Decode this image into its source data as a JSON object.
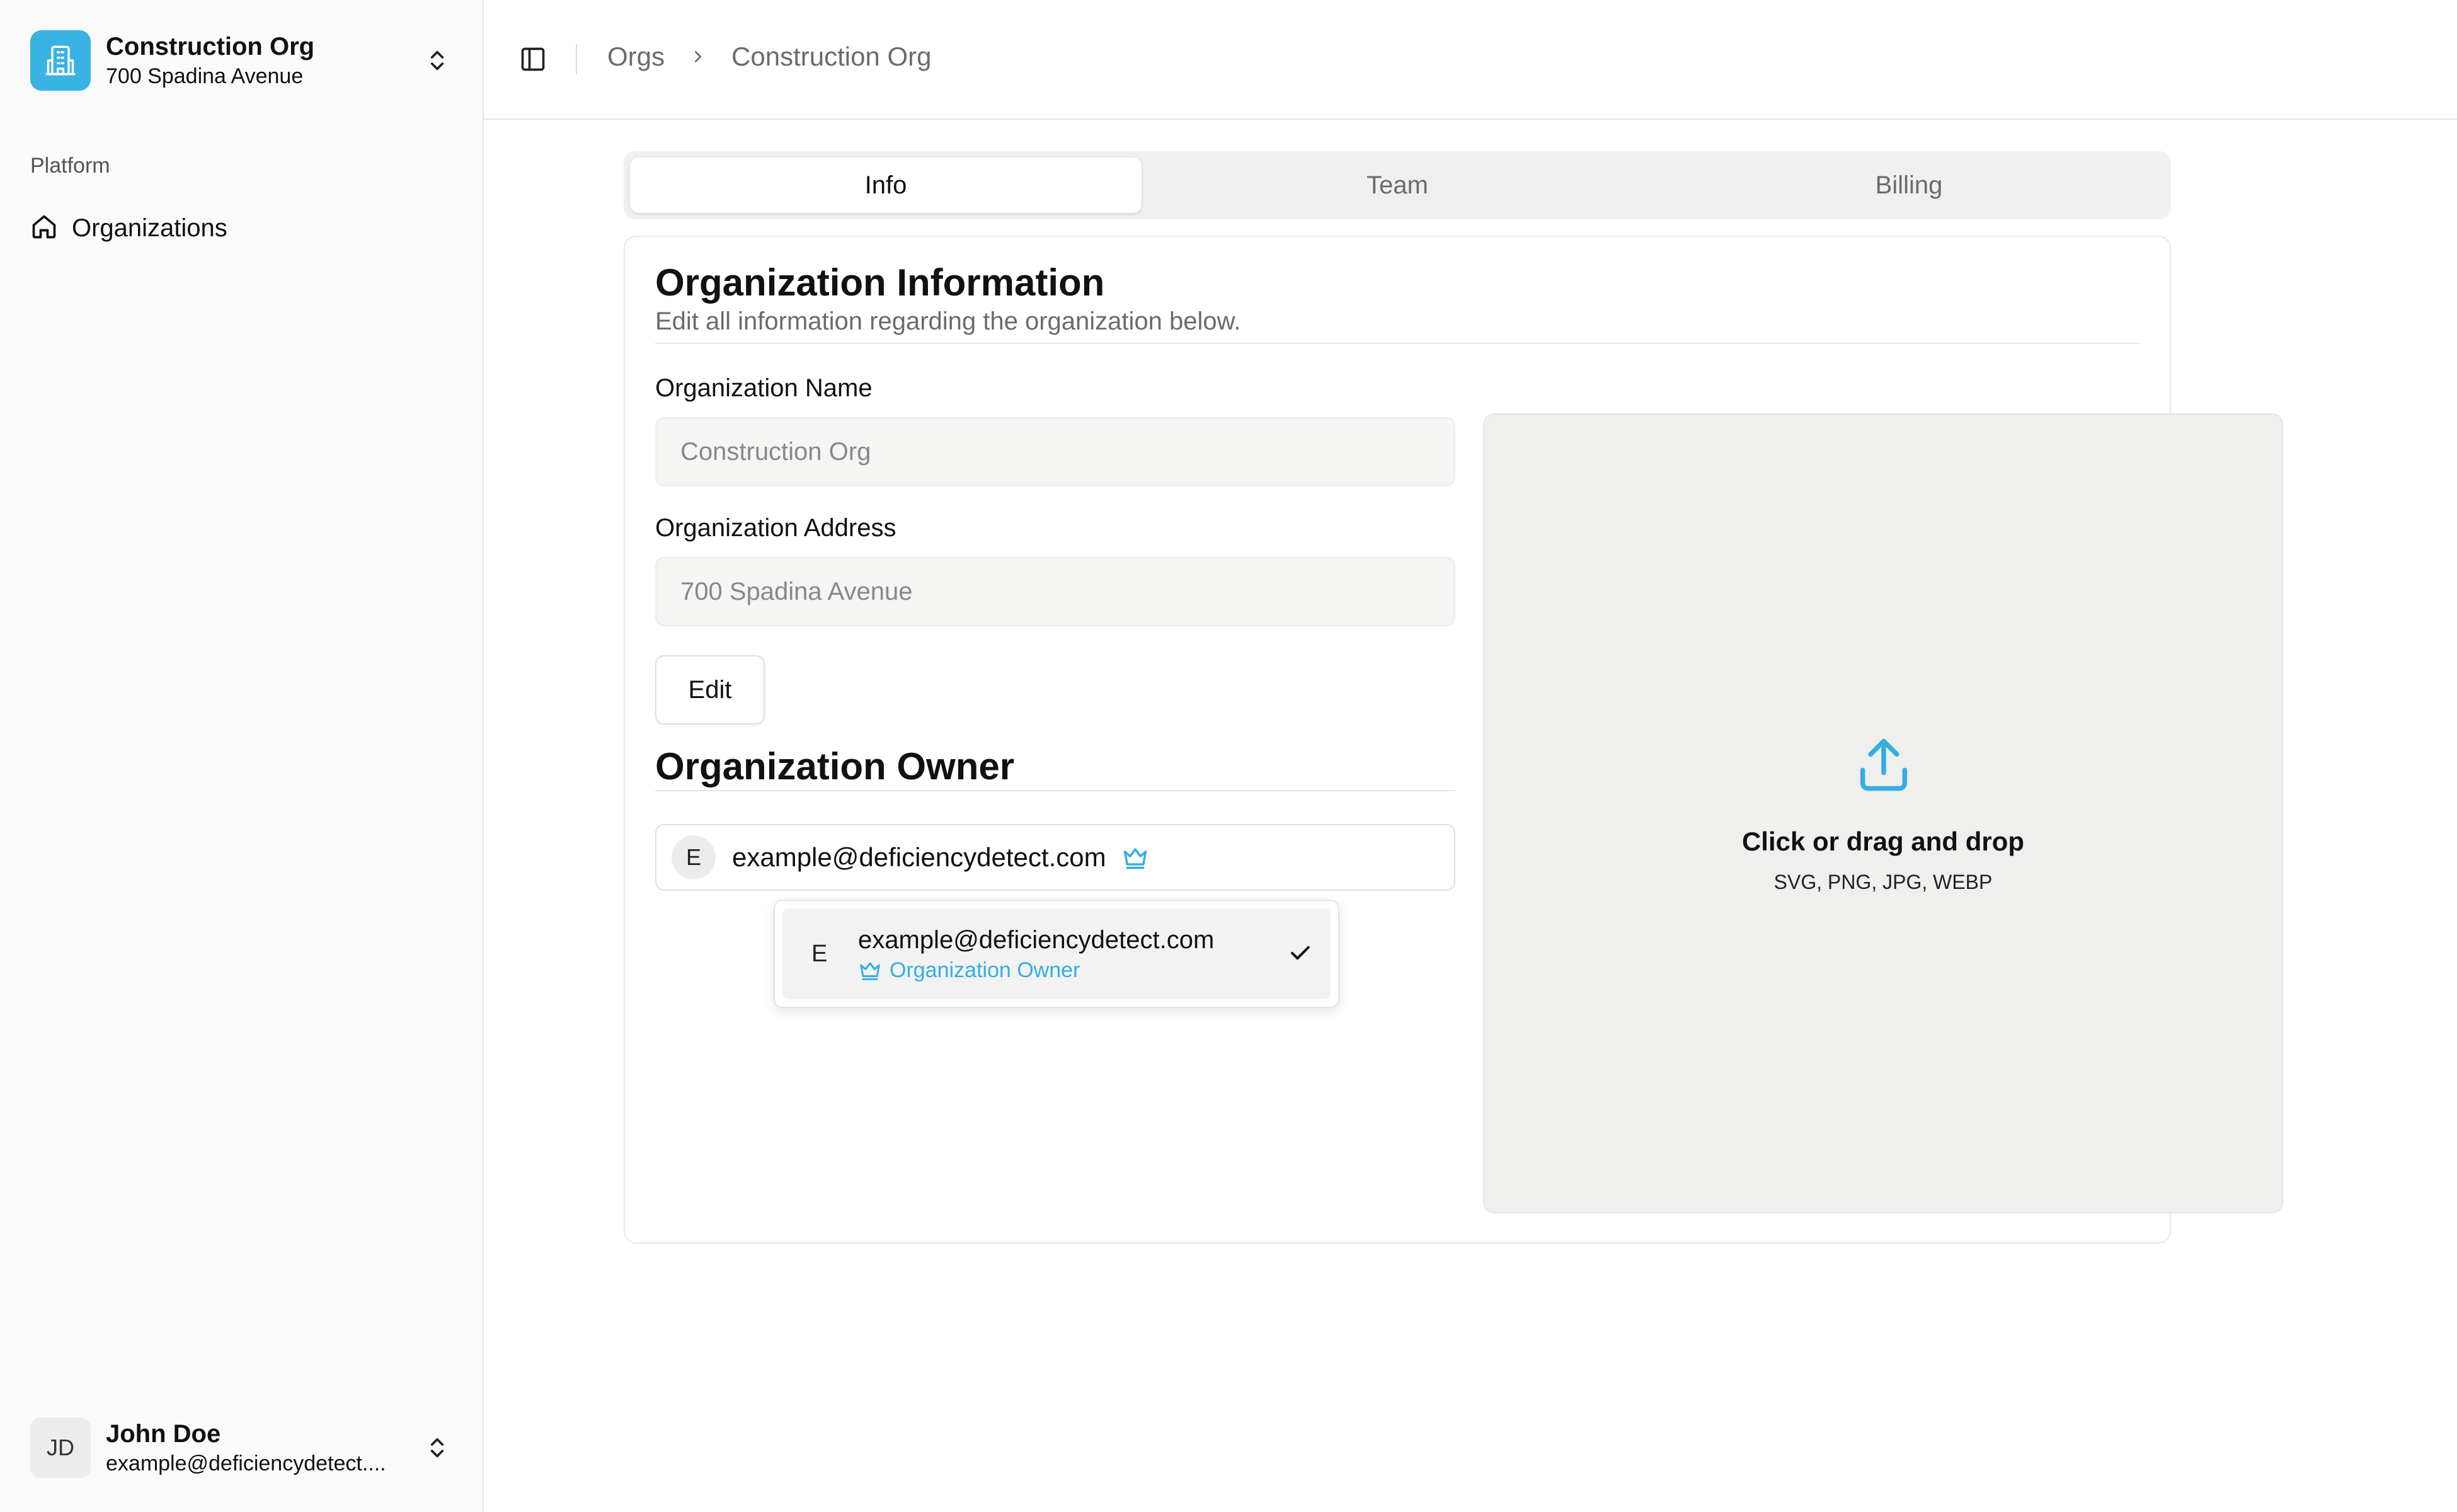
{
  "sidebar": {
    "org": {
      "name": "Construction Org",
      "address": "700 Spadina Avenue",
      "logo_icon": "building-icon",
      "logo_color": "#38b3e3"
    },
    "nav_group_label": "Platform",
    "nav_items": [
      {
        "label": "Organizations",
        "icon": "home-icon"
      }
    ],
    "user": {
      "initials": "JD",
      "name": "John Doe",
      "email": "example@deficiencydetect...."
    }
  },
  "breadcrumb": {
    "items": [
      "Orgs",
      "Construction Org"
    ]
  },
  "tabs": [
    {
      "label": "Info",
      "active": true
    },
    {
      "label": "Team",
      "active": false
    },
    {
      "label": "Billing",
      "active": false
    }
  ],
  "info": {
    "title": "Organization Information",
    "subtitle": "Edit all information regarding the organization below.",
    "name_label": "Organization Name",
    "name_value": "Construction Org",
    "address_label": "Organization Address",
    "address_value": "700 Spadina Avenue",
    "edit_label": "Edit"
  },
  "owner": {
    "title": "Organization Owner",
    "selected": {
      "initial": "E",
      "email": "example@deficiencydetect.com"
    },
    "options": [
      {
        "initial": "E",
        "email": "example@deficiencydetect.com",
        "role": "Organization Owner",
        "selected": true
      }
    ]
  },
  "upload": {
    "title": "Click or drag and drop",
    "formats": "SVG, PNG, JPG, WEBP",
    "accent_color": "#35aee0"
  }
}
